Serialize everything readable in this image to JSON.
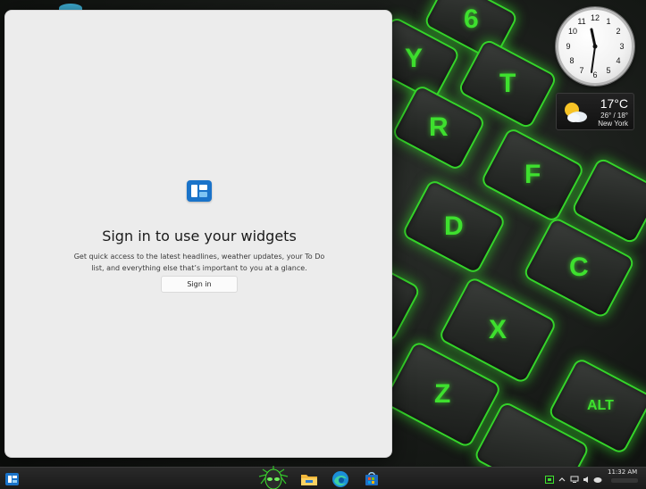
{
  "widgets_panel": {
    "title": "Sign in to use your widgets",
    "description": "Get quick access to the latest headlines, weather updates, your To Do list, and everything else that’s important to you at a glance.",
    "signin_label": "Sign in"
  },
  "clock_gadget": {
    "numbers": [
      "12",
      "1",
      "2",
      "3",
      "4",
      "5",
      "6",
      "7",
      "8",
      "9",
      "10",
      "11"
    ]
  },
  "weather_gadget": {
    "temperature": "17°C",
    "range": "26° / 18°",
    "city": "New York",
    "icon": "partly-cloudy-icon"
  },
  "wallpaper": {
    "keys": [
      "6",
      "Y",
      "T",
      "R",
      "F",
      "D",
      "C",
      "X",
      "Z",
      "ALT"
    ]
  },
  "taskbar": {
    "clock_time": "11:32 AM",
    "apps": [
      "widgets-icon",
      "alienware-icon",
      "file-explorer-icon",
      "edge-icon",
      "store-icon"
    ]
  },
  "colors": {
    "key_glow": "#35d42a",
    "panel_bg": "#ececec",
    "accent": "#1a73c9"
  }
}
